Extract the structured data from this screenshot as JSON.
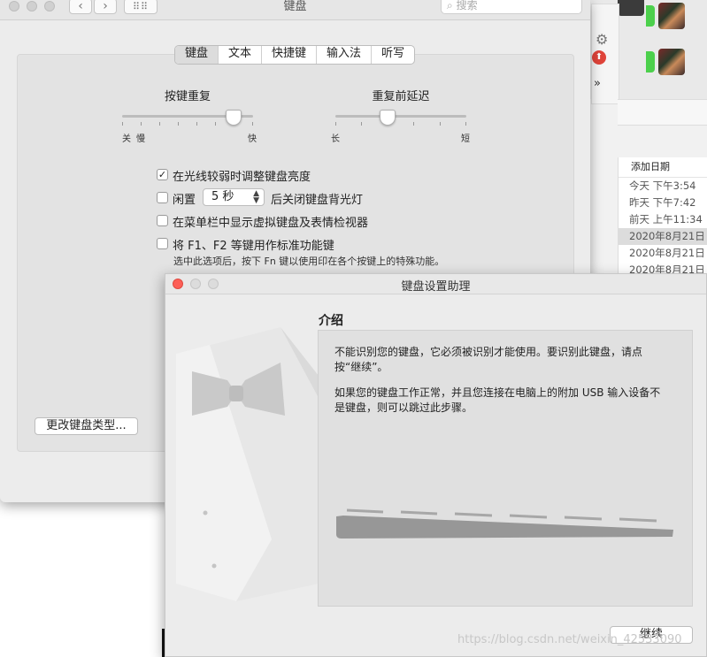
{
  "background_app": {
    "list_header": "添加日期",
    "list_rows": [
      "今天 下午3:54",
      "昨天 下午7:42",
      "前天 上午11:34",
      "2020年8月21日",
      "2020年8月21日",
      "2020年8月21日"
    ],
    "chevron": "»"
  },
  "prefs": {
    "title": "键盘",
    "search_placeholder": "搜索",
    "tabs": [
      "键盘",
      "文本",
      "快捷键",
      "输入法",
      "听写"
    ],
    "active_tab": 0,
    "key_repeat": {
      "label": "按键重复",
      "left": "关",
      "left2": "慢",
      "right": "快",
      "value": 0.85
    },
    "delay_until_repeat": {
      "label": "重复前延迟",
      "left": "长",
      "right": "短",
      "value": 0.4
    },
    "options": {
      "adjust_brightness": {
        "label": "在光线较弱时调整键盘亮度",
        "checked": true
      },
      "backlight_off": {
        "prefix": "闲置",
        "value": "5 秒",
        "suffix": "后关闭键盘背光灯",
        "checked": false
      },
      "show_viewers": {
        "label": "在菜单栏中显示虚拟键盘及表情检视器",
        "checked": false
      },
      "fn_keys": {
        "label": "将 F1、F2 等键用作标准功能键",
        "checked": false,
        "note": "选中此选项后，按下 Fn 键以使用印在各个按键上的特殊功能。"
      }
    },
    "change_type_button": "更改键盘类型..."
  },
  "assistant": {
    "title": "键盘设置助理",
    "section": "介绍",
    "para1_line1": "不能识别您的键盘，它必须被识别才能使用。要识别此键盘，请点",
    "para1_line2": "按“继续”。",
    "para2_line1": "如果您的键盘工作正常，并且您连接在电脑上的附加 USB 输入设备不",
    "para2_line2": "是键盘，则可以跳过此步骤。",
    "continue_button": "继续"
  },
  "watermark": "https://blog.csdn.net/weixin_42533090",
  "colors": {
    "close_red": "#fd5f57",
    "green_indicator": "#4cd04c",
    "alert_red": "#e0443a"
  },
  "icons": [
    "back-arrow-icon",
    "forward-arrow-icon",
    "grid-icon",
    "search-icon",
    "checkmark-icon",
    "gear-icon",
    "upload-alert-icon",
    "tuxedo-illustration",
    "keyboard-illustration"
  ]
}
